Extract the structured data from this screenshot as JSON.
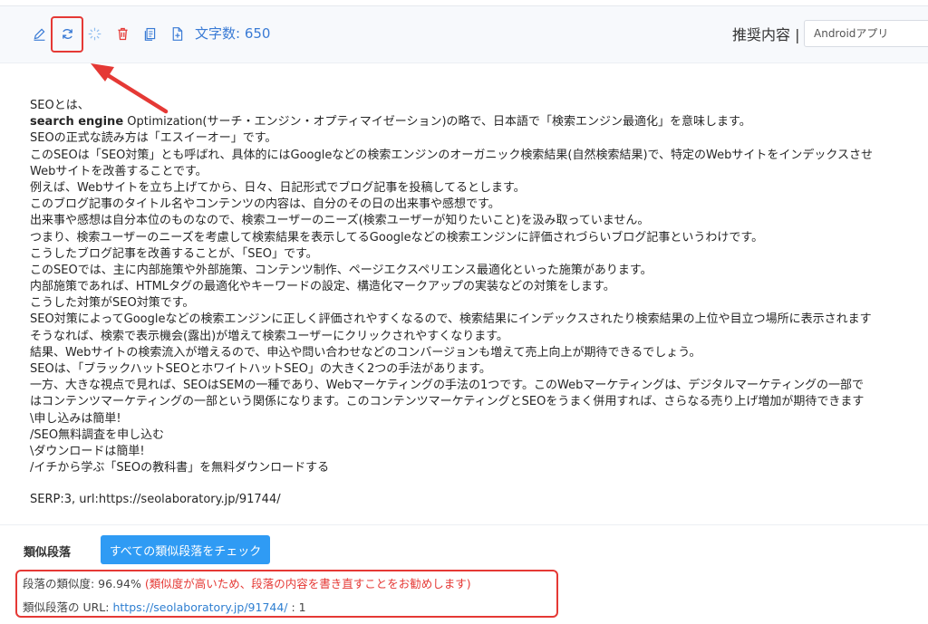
{
  "toolbar": {
    "icons": [
      "edit-icon",
      "refresh-icon",
      "sparkle-icon",
      "delete-icon",
      "copy-icon",
      "add-document-icon"
    ],
    "char_count_label": "文字数: 650",
    "recommend_label": "推奨内容 |",
    "recommend_value": "Androidアプリ"
  },
  "content": {
    "intro": "SEOとは、",
    "line1_bold": "search engine",
    "line1_rest": " Optimization(サーチ・エンジン・オプティマイゼーション)の略で、日本語で「検索エンジン最適化」を意味します。",
    "lines": [
      "SEOの正式な読み方は「エスイーオー」です。",
      "このSEOは「SEO対策」とも呼ばれ、具体的にはGoogleなどの検索エンジンのオーガニック検索結果(自然検索結果)で、特定のWebサイトをインデックスさせ",
      "Webサイトを改善することです。",
      "例えば、Webサイトを立ち上げてから、日々、日記形式でブログ記事を投稿してるとします。",
      "このブログ記事のタイトル名やコンテンツの内容は、自分のその日の出来事や感想です。",
      "出来事や感想は自分本位のものなので、検索ユーザーのニーズ(検索ユーザーが知りたいこと)を汲み取っていません。",
      "つまり、検索ユーザーのニーズを考慮して検索結果を表示してるGoogleなどの検索エンジンに評価されづらいブログ記事というわけです。",
      "こうしたブログ記事を改善することが、「SEO」です。",
      "このSEOでは、主に内部施策や外部施策、コンテンツ制作、ページエクスペリエンス最適化といった施策があります。",
      "内部施策であれば、HTMLタグの最適化やキーワードの設定、構造化マークアップの実装などの対策をします。",
      "こうした対策がSEO対策です。",
      "SEO対策によってGoogleなどの検索エンジンに正しく評価されやすくなるので、検索結果にインデックスされたり検索結果の上位や目立つ場所に表示されます",
      "そうなれば、検索で表示機会(露出)が増えて検索ユーザーにクリックされやすくなります。",
      "結果、Webサイトの検索流入が増えるので、申込や問い合わせなどのコンバージョンも増えて売上向上が期待できるでしょう。",
      "SEOは、「ブラックハットSEOとホワイトハットSEO」の大きく2つの手法があります。",
      "一方、大きな視点で見れば、SEOはSEMの一種であり、Webマーケティングの手法の1つです。このWebマーケティングは、デジタルマーケティングの一部で",
      "はコンテンツマーケティングの一部という関係になります。このコンテンツマーケティングとSEOをうまく併用すれば、さらなる売り上げ増加が期待できます",
      "\\申し込みは簡単!",
      "/SEO無料調査を申し込む",
      "\\ダウンロードは簡単!",
      "/イチから学ぶ「SEOの教科書」を無料ダウンロードする"
    ],
    "serp": "SERP:3, url:https://seolaboratory.jp/91744/"
  },
  "similar": {
    "title": "類似段落",
    "check_button": "すべての類似段落をチェック",
    "similarity_label": "段落の類似度: 96.94%",
    "warning": "(類似度が高いため、段落の内容を書き直すことをお勧めします)",
    "url_label": "類似段落の URL: ",
    "url": "https://seolaboratory.jp/91744/",
    "url_suffix": " : 1"
  },
  "colors": {
    "accent": "#2f9bf4",
    "link": "#2f7fd1",
    "warning": "#e53935",
    "delete": "#e53935"
  }
}
